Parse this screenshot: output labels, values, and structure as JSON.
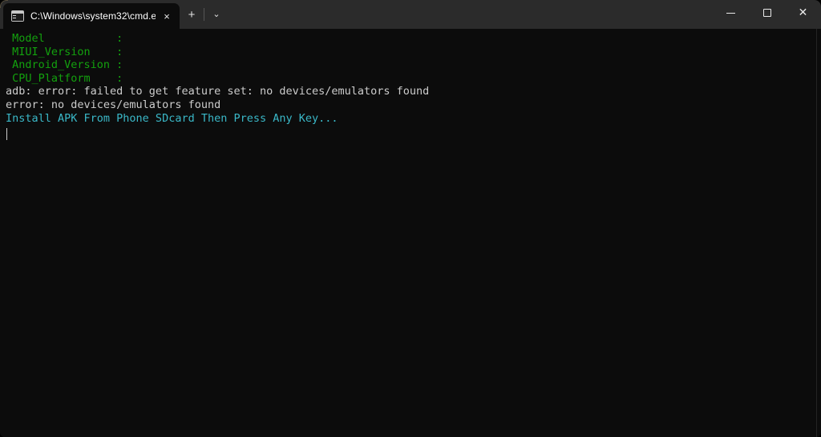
{
  "window": {
    "background": "#0c0c0c",
    "titlebar_background": "#2b2b2b"
  },
  "titlebar": {
    "tab": {
      "icon": "console-icon",
      "title": "C:\\Windows\\system32\\cmd.e:",
      "close_label": "×"
    },
    "new_tab_label": "+",
    "dropdown_label": "⌄",
    "controls": {
      "minimize_label": "—",
      "maximize_label": "□",
      "close_label": "✕"
    }
  },
  "terminal": {
    "colors": {
      "green": "#13a10e",
      "white": "#cccccc",
      "cyan": "#3ab8c8",
      "background": "#0c0c0c"
    },
    "lines": [
      {
        "text": " Model           :",
        "color": "green"
      },
      {
        "text": " MIUI_Version    :",
        "color": "green"
      },
      {
        "text": " Android_Version :",
        "color": "green"
      },
      {
        "text": " CPU_Platform    :",
        "color": "green"
      },
      {
        "text": "adb: error: failed to get feature set: no devices/emulators found",
        "color": "white"
      },
      {
        "text": "error: no devices/emulators found",
        "color": "white"
      },
      {
        "text": "Install APK From Phone SDcard Then Press Any Key...",
        "color": "cyan"
      }
    ],
    "cursor": "|"
  }
}
